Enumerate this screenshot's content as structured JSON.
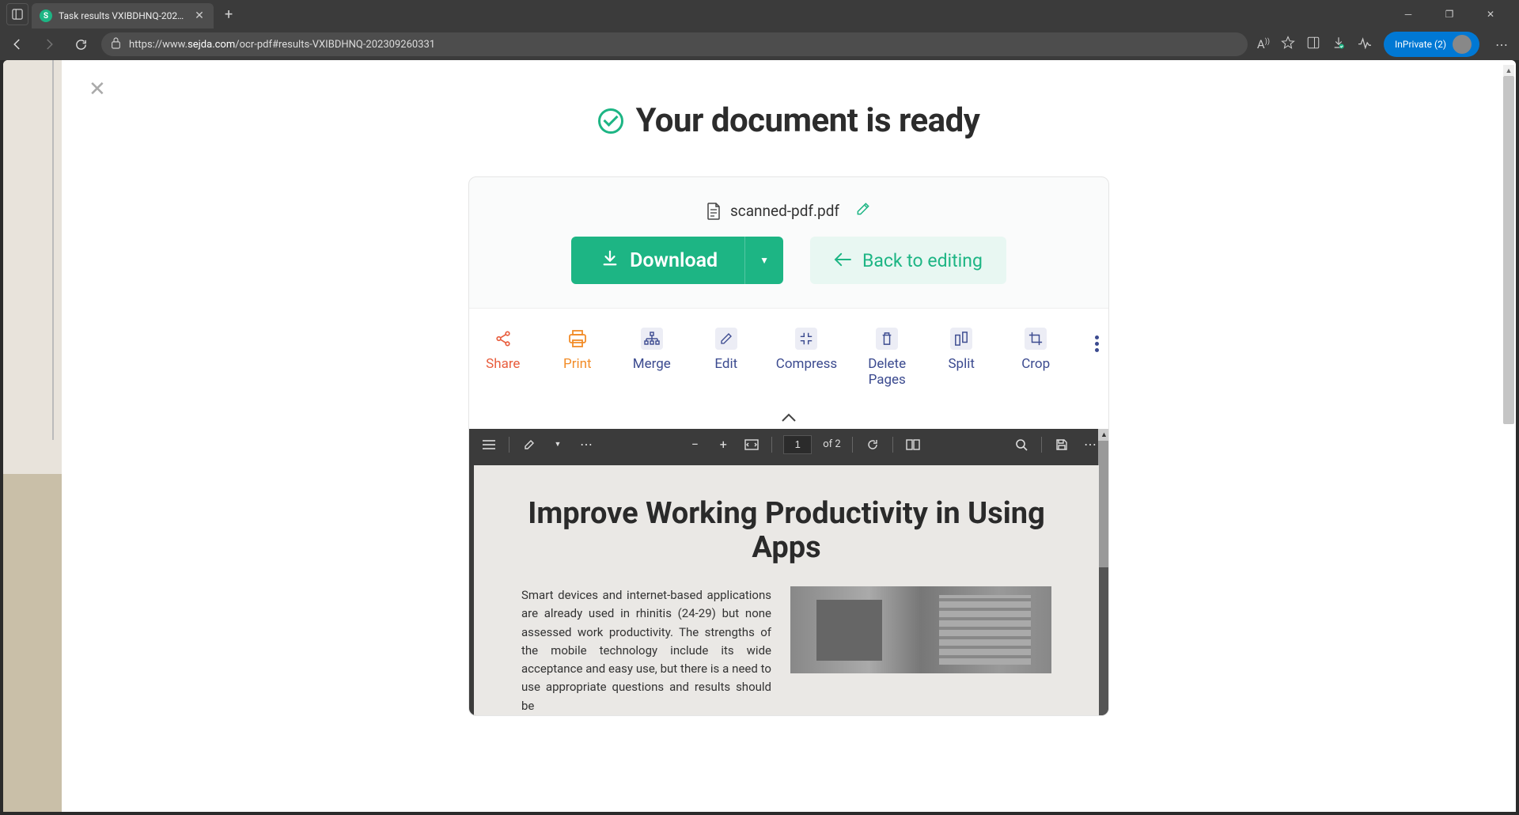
{
  "browser": {
    "tab_title": "Task results VXIBDHNQ-2023092",
    "tab_favicon_letter": "S",
    "url_prefix": "https://www.",
    "url_domain": "sejda.com",
    "url_path": "/ocr-pdf#results-VXIBDHNQ-202309260331",
    "inprivate_label": "InPrivate (2)"
  },
  "page": {
    "heading": "Your document is ready",
    "file_name": "scanned-pdf.pdf",
    "download_label": "Download",
    "back_label": "Back to editing",
    "tools": [
      {
        "key": "share",
        "label": "Share"
      },
      {
        "key": "print",
        "label": "Print"
      },
      {
        "key": "merge",
        "label": "Merge"
      },
      {
        "key": "edit",
        "label": "Edit"
      },
      {
        "key": "compress",
        "label": "Compress"
      },
      {
        "key": "delete",
        "label": "Delete\nPages"
      },
      {
        "key": "split",
        "label": "Split"
      },
      {
        "key": "crop",
        "label": "Crop"
      }
    ]
  },
  "pdf": {
    "current_page": "1",
    "total_pages": "of 2",
    "doc_title": "Improve Working Productivity in Using Apps",
    "doc_paragraph": "Smart devices and internet-based applications are already used in rhinitis (24-29) but none assessed work productivity. The strengths of the mobile technology include its wide acceptance and easy use, but there is a need to use appropriate questions and results should be"
  }
}
